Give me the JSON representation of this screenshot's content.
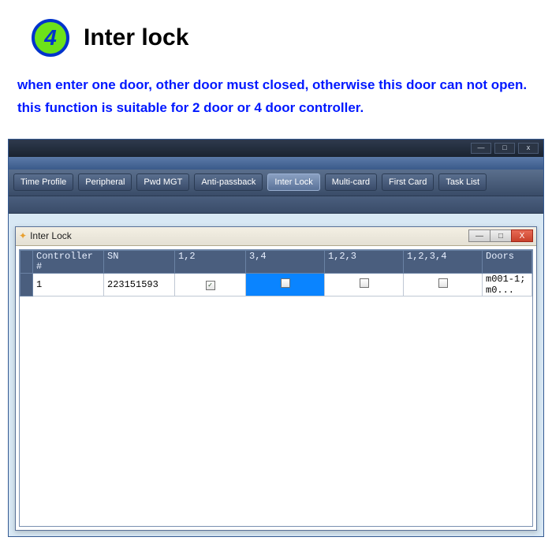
{
  "hero": {
    "step_number": "4",
    "title": "Inter lock",
    "description": "when enter one door, other door must closed, otherwise this door can not open.  this function is suitable for 2 door or 4 door controller."
  },
  "toolbar": {
    "items": [
      "Time Profile",
      "Peripheral",
      "Pwd MGT",
      "Anti-passback",
      "Inter Lock",
      "Multi-card",
      "First Card",
      "Task List"
    ],
    "active_index": 4
  },
  "dialog": {
    "title": "Inter Lock"
  },
  "grid": {
    "headers": [
      "Controller#",
      "SN",
      "1,2",
      "3,4",
      "1,2,3",
      "1,2,3,4",
      "Doors"
    ],
    "rows": [
      {
        "controller": "1",
        "sn": "223151593",
        "c12_checked": true,
        "c34_checked": false,
        "c123_checked": false,
        "c1234_checked": false,
        "doors": "m001-1;  m0...",
        "selected_col": "3,4"
      }
    ]
  },
  "window_controls": {
    "minimize": "—",
    "maximize": "□",
    "close": "X"
  }
}
